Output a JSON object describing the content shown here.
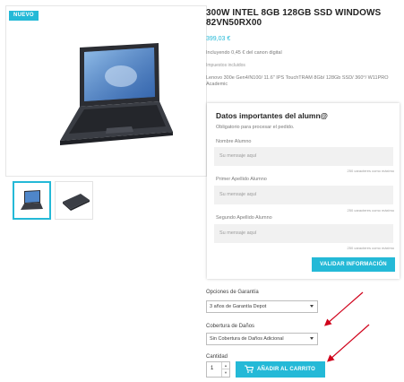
{
  "product": {
    "badge": "NUEVO",
    "title": "300W INTEL 8GB 128GB SSD WINDOWS 82VN50RX00",
    "price": "399,03 €",
    "tax_note": "Incluyendo 0,45 € del canon digital",
    "tax_included": "Impuestos incluidos",
    "description": "Lenovo 300e Gen4/N100/ 11.6\" IPS TouchTRAM 8Gb/ 128Gb SSD/ 360°/ W11PRO Academic"
  },
  "gallery": {
    "thumbnails": [
      "laptop-open-thumbnail",
      "laptop-closed-thumbnail"
    ]
  },
  "student_form": {
    "title": "Datos importantes del alumn@",
    "subtitle": "Obligatorio para procesar el pedido.",
    "fields": [
      {
        "label": "Nombre Alumno",
        "placeholder": "Su mensaje aquí",
        "counter": "250 caracteres como máximo"
      },
      {
        "label": "Primer Apellido Alumno",
        "placeholder": "Su mensaje aquí",
        "counter": "250 caracteres como máximo"
      },
      {
        "label": "Segundo Apellido Alumno",
        "placeholder": "Su mensaje aquí",
        "counter": "250 caracteres como máximo"
      }
    ],
    "validate_label": "VALIDAR INFORMACIÓN"
  },
  "options": {
    "warranty_label": "Opciones de Garantía",
    "warranty_value": "3 años de Garantía Depot",
    "damage_label": "Cobertura de Daños",
    "damage_value": "Sin Cobertura de Daños Adicional",
    "quantity_label": "Cantidad",
    "quantity_value": "1",
    "add_to_cart_label": "AÑADIR AL CARRITO"
  },
  "colors": {
    "accent": "#24b9d7",
    "annotation_arrow": "#d0021b"
  }
}
